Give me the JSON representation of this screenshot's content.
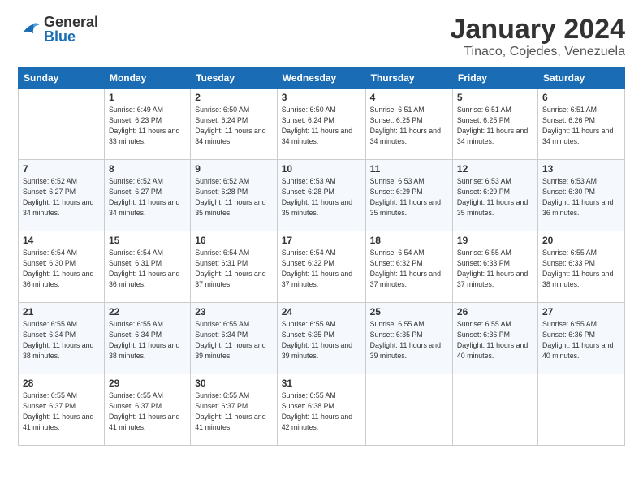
{
  "header": {
    "logo_general": "General",
    "logo_blue": "Blue",
    "title": "January 2024",
    "location": "Tinaco, Cojedes, Venezuela"
  },
  "days_of_week": [
    "Sunday",
    "Monday",
    "Tuesday",
    "Wednesday",
    "Thursday",
    "Friday",
    "Saturday"
  ],
  "weeks": [
    [
      {
        "day": "",
        "sunrise": "",
        "sunset": "",
        "daylight": ""
      },
      {
        "day": "1",
        "sunrise": "Sunrise: 6:49 AM",
        "sunset": "Sunset: 6:23 PM",
        "daylight": "Daylight: 11 hours and 33 minutes."
      },
      {
        "day": "2",
        "sunrise": "Sunrise: 6:50 AM",
        "sunset": "Sunset: 6:24 PM",
        "daylight": "Daylight: 11 hours and 34 minutes."
      },
      {
        "day": "3",
        "sunrise": "Sunrise: 6:50 AM",
        "sunset": "Sunset: 6:24 PM",
        "daylight": "Daylight: 11 hours and 34 minutes."
      },
      {
        "day": "4",
        "sunrise": "Sunrise: 6:51 AM",
        "sunset": "Sunset: 6:25 PM",
        "daylight": "Daylight: 11 hours and 34 minutes."
      },
      {
        "day": "5",
        "sunrise": "Sunrise: 6:51 AM",
        "sunset": "Sunset: 6:25 PM",
        "daylight": "Daylight: 11 hours and 34 minutes."
      },
      {
        "day": "6",
        "sunrise": "Sunrise: 6:51 AM",
        "sunset": "Sunset: 6:26 PM",
        "daylight": "Daylight: 11 hours and 34 minutes."
      }
    ],
    [
      {
        "day": "7",
        "sunrise": "Sunrise: 6:52 AM",
        "sunset": "Sunset: 6:27 PM",
        "daylight": "Daylight: 11 hours and 34 minutes."
      },
      {
        "day": "8",
        "sunrise": "Sunrise: 6:52 AM",
        "sunset": "Sunset: 6:27 PM",
        "daylight": "Daylight: 11 hours and 34 minutes."
      },
      {
        "day": "9",
        "sunrise": "Sunrise: 6:52 AM",
        "sunset": "Sunset: 6:28 PM",
        "daylight": "Daylight: 11 hours and 35 minutes."
      },
      {
        "day": "10",
        "sunrise": "Sunrise: 6:53 AM",
        "sunset": "Sunset: 6:28 PM",
        "daylight": "Daylight: 11 hours and 35 minutes."
      },
      {
        "day": "11",
        "sunrise": "Sunrise: 6:53 AM",
        "sunset": "Sunset: 6:29 PM",
        "daylight": "Daylight: 11 hours and 35 minutes."
      },
      {
        "day": "12",
        "sunrise": "Sunrise: 6:53 AM",
        "sunset": "Sunset: 6:29 PM",
        "daylight": "Daylight: 11 hours and 35 minutes."
      },
      {
        "day": "13",
        "sunrise": "Sunrise: 6:53 AM",
        "sunset": "Sunset: 6:30 PM",
        "daylight": "Daylight: 11 hours and 36 minutes."
      }
    ],
    [
      {
        "day": "14",
        "sunrise": "Sunrise: 6:54 AM",
        "sunset": "Sunset: 6:30 PM",
        "daylight": "Daylight: 11 hours and 36 minutes."
      },
      {
        "day": "15",
        "sunrise": "Sunrise: 6:54 AM",
        "sunset": "Sunset: 6:31 PM",
        "daylight": "Daylight: 11 hours and 36 minutes."
      },
      {
        "day": "16",
        "sunrise": "Sunrise: 6:54 AM",
        "sunset": "Sunset: 6:31 PM",
        "daylight": "Daylight: 11 hours and 37 minutes."
      },
      {
        "day": "17",
        "sunrise": "Sunrise: 6:54 AM",
        "sunset": "Sunset: 6:32 PM",
        "daylight": "Daylight: 11 hours and 37 minutes."
      },
      {
        "day": "18",
        "sunrise": "Sunrise: 6:54 AM",
        "sunset": "Sunset: 6:32 PM",
        "daylight": "Daylight: 11 hours and 37 minutes."
      },
      {
        "day": "19",
        "sunrise": "Sunrise: 6:55 AM",
        "sunset": "Sunset: 6:33 PM",
        "daylight": "Daylight: 11 hours and 37 minutes."
      },
      {
        "day": "20",
        "sunrise": "Sunrise: 6:55 AM",
        "sunset": "Sunset: 6:33 PM",
        "daylight": "Daylight: 11 hours and 38 minutes."
      }
    ],
    [
      {
        "day": "21",
        "sunrise": "Sunrise: 6:55 AM",
        "sunset": "Sunset: 6:34 PM",
        "daylight": "Daylight: 11 hours and 38 minutes."
      },
      {
        "day": "22",
        "sunrise": "Sunrise: 6:55 AM",
        "sunset": "Sunset: 6:34 PM",
        "daylight": "Daylight: 11 hours and 38 minutes."
      },
      {
        "day": "23",
        "sunrise": "Sunrise: 6:55 AM",
        "sunset": "Sunset: 6:34 PM",
        "daylight": "Daylight: 11 hours and 39 minutes."
      },
      {
        "day": "24",
        "sunrise": "Sunrise: 6:55 AM",
        "sunset": "Sunset: 6:35 PM",
        "daylight": "Daylight: 11 hours and 39 minutes."
      },
      {
        "day": "25",
        "sunrise": "Sunrise: 6:55 AM",
        "sunset": "Sunset: 6:35 PM",
        "daylight": "Daylight: 11 hours and 39 minutes."
      },
      {
        "day": "26",
        "sunrise": "Sunrise: 6:55 AM",
        "sunset": "Sunset: 6:36 PM",
        "daylight": "Daylight: 11 hours and 40 minutes."
      },
      {
        "day": "27",
        "sunrise": "Sunrise: 6:55 AM",
        "sunset": "Sunset: 6:36 PM",
        "daylight": "Daylight: 11 hours and 40 minutes."
      }
    ],
    [
      {
        "day": "28",
        "sunrise": "Sunrise: 6:55 AM",
        "sunset": "Sunset: 6:37 PM",
        "daylight": "Daylight: 11 hours and 41 minutes."
      },
      {
        "day": "29",
        "sunrise": "Sunrise: 6:55 AM",
        "sunset": "Sunset: 6:37 PM",
        "daylight": "Daylight: 11 hours and 41 minutes."
      },
      {
        "day": "30",
        "sunrise": "Sunrise: 6:55 AM",
        "sunset": "Sunset: 6:37 PM",
        "daylight": "Daylight: 11 hours and 41 minutes."
      },
      {
        "day": "31",
        "sunrise": "Sunrise: 6:55 AM",
        "sunset": "Sunset: 6:38 PM",
        "daylight": "Daylight: 11 hours and 42 minutes."
      },
      {
        "day": "",
        "sunrise": "",
        "sunset": "",
        "daylight": ""
      },
      {
        "day": "",
        "sunrise": "",
        "sunset": "",
        "daylight": ""
      },
      {
        "day": "",
        "sunrise": "",
        "sunset": "",
        "daylight": ""
      }
    ]
  ]
}
